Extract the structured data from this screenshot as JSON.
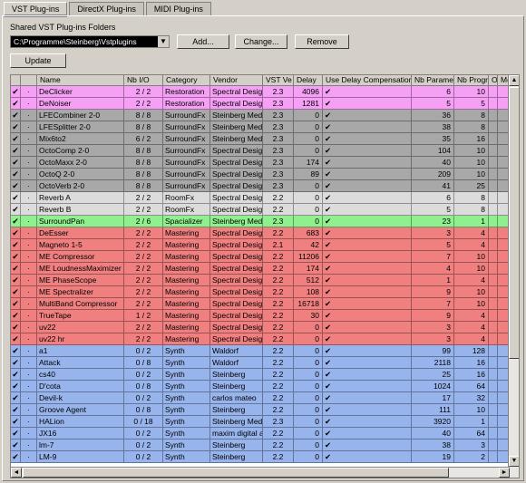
{
  "tabs": [
    "VST Plug-ins",
    "DirectX Plug-ins",
    "MIDI Plug-ins"
  ],
  "folders_label": "Shared VST Plug-ins Folders",
  "path": "C:\\Programme\\Steinberg\\Vstplugins",
  "buttons": {
    "add": "Add...",
    "change": "Change...",
    "remove": "Remove",
    "update": "Update"
  },
  "colors": {
    "pink": "#f5a0f5",
    "gray": "#a8a8a8",
    "light": "#dcdcdc",
    "green": "#90f090",
    "red": "#f07f7f",
    "blue": "#98b4ec"
  },
  "columns": [
    "",
    "",
    "Name",
    "Nb I/O",
    "Category",
    "Vendor",
    "VST Ve",
    "Delay",
    "Use Delay Compensation",
    "Nb Parame",
    "Nb Progra",
    "O",
    "Me"
  ],
  "rows": [
    {
      "on": "✔",
      "m": "·",
      "name": "DeClicker",
      "io": "2 / 2",
      "cat": "Restoration",
      "vendor": "Spectral Design",
      "ver": "2.3",
      "delay": "4096",
      "udc": "✔",
      "params": "6",
      "progs": "10",
      "color": "pink"
    },
    {
      "on": "✔",
      "m": "·",
      "name": "DeNoiser",
      "io": "2 / 2",
      "cat": "Restoration",
      "vendor": "Spectral Design",
      "ver": "2.3",
      "delay": "1281",
      "udc": "✔",
      "params": "5",
      "progs": "5",
      "color": "pink"
    },
    {
      "on": "✔",
      "m": "·",
      "name": "LFECombiner 2-0",
      "io": "8 / 8",
      "cat": "SurroundFx",
      "vendor": "Steinberg Media",
      "ver": "2.3",
      "delay": "0",
      "udc": "✔",
      "params": "36",
      "progs": "8",
      "color": "gray"
    },
    {
      "on": "✔",
      "m": "·",
      "name": "LFESplitter 2-0",
      "io": "8 / 8",
      "cat": "SurroundFx",
      "vendor": "Steinberg Media",
      "ver": "2.3",
      "delay": "0",
      "udc": "✔",
      "params": "38",
      "progs": "8",
      "color": "gray"
    },
    {
      "on": "✔",
      "m": "·",
      "name": "Mix6to2",
      "io": "6 / 2",
      "cat": "SurroundFx",
      "vendor": "Steinberg Media",
      "ver": "2.3",
      "delay": "0",
      "udc": "✔",
      "params": "35",
      "progs": "16",
      "color": "gray"
    },
    {
      "on": "✔",
      "m": "·",
      "name": "OctoComp 2-0",
      "io": "8 / 8",
      "cat": "SurroundFx",
      "vendor": "Spectral Design",
      "ver": "2.3",
      "delay": "0",
      "udc": "✔",
      "params": "104",
      "progs": "10",
      "color": "gray"
    },
    {
      "on": "✔",
      "m": "·",
      "name": "OctoMaxx 2-0",
      "io": "8 / 8",
      "cat": "SurroundFx",
      "vendor": "Spectral Design",
      "ver": "2.3",
      "delay": "174",
      "udc": "✔",
      "params": "40",
      "progs": "10",
      "color": "gray"
    },
    {
      "on": "✔",
      "m": "·",
      "name": "OctoQ 2-0",
      "io": "8 / 8",
      "cat": "SurroundFx",
      "vendor": "Spectral Design",
      "ver": "2.3",
      "delay": "89",
      "udc": "✔",
      "params": "209",
      "progs": "10",
      "color": "gray"
    },
    {
      "on": "✔",
      "m": "·",
      "name": "OctoVerb 2-0",
      "io": "8 / 8",
      "cat": "SurroundFx",
      "vendor": "Spectral Design",
      "ver": "2.3",
      "delay": "0",
      "udc": "✔",
      "params": "41",
      "progs": "25",
      "color": "gray"
    },
    {
      "on": "✔",
      "m": "·",
      "name": "Reverb A",
      "io": "2 / 2",
      "cat": "RoomFx",
      "vendor": "Spectral Design",
      "ver": "2.2",
      "delay": "0",
      "udc": "✔",
      "params": "6",
      "progs": "8",
      "color": "light"
    },
    {
      "on": "✔",
      "m": "·",
      "name": "Reverb B",
      "io": "2 / 2",
      "cat": "RoomFx",
      "vendor": "Spectral Design",
      "ver": "2.2",
      "delay": "0",
      "udc": "✔",
      "params": "5",
      "progs": "8",
      "color": "light"
    },
    {
      "on": "✔",
      "m": "·",
      "name": "SurroundPan",
      "io": "2 / 6",
      "cat": "Spacializer",
      "vendor": "Steinberg Media",
      "ver": "2.3",
      "delay": "0",
      "udc": "✔",
      "params": "23",
      "progs": "1",
      "color": "green"
    },
    {
      "on": "✔",
      "m": "·",
      "name": "DeEsser",
      "io": "2 / 2",
      "cat": "Mastering",
      "vendor": "Spectral Design",
      "ver": "2.2",
      "delay": "683",
      "udc": "✔",
      "params": "3",
      "progs": "4",
      "color": "red"
    },
    {
      "on": "✔",
      "m": "·",
      "name": "Magneto 1-5",
      "io": "2 / 2",
      "cat": "Mastering",
      "vendor": "Spectral Design",
      "ver": "2.1",
      "delay": "42",
      "udc": "✔",
      "params": "5",
      "progs": "4",
      "color": "red"
    },
    {
      "on": "✔",
      "m": "·",
      "name": "ME Compressor",
      "io": "2 / 2",
      "cat": "Mastering",
      "vendor": "Spectral Design",
      "ver": "2.2",
      "delay": "11206",
      "udc": "✔",
      "params": "7",
      "progs": "10",
      "color": "red"
    },
    {
      "on": "✔",
      "m": "·",
      "name": "ME LoudnessMaximizer",
      "io": "2 / 2",
      "cat": "Mastering",
      "vendor": "Spectral Design",
      "ver": "2.2",
      "delay": "174",
      "udc": "✔",
      "params": "4",
      "progs": "10",
      "color": "red"
    },
    {
      "on": "✔",
      "m": "·",
      "name": "ME PhaseScope",
      "io": "2 / 2",
      "cat": "Mastering",
      "vendor": "Spectral Design",
      "ver": "2.2",
      "delay": "512",
      "udc": "✔",
      "params": "1",
      "progs": "4",
      "color": "red"
    },
    {
      "on": "✔",
      "m": "·",
      "name": "ME Spectralizer",
      "io": "2 / 2",
      "cat": "Mastering",
      "vendor": "Spectral Design",
      "ver": "2.2",
      "delay": "108",
      "udc": "✔",
      "params": "9",
      "progs": "10",
      "color": "red"
    },
    {
      "on": "✔",
      "m": "·",
      "name": "MultiBand Compressor",
      "io": "2 / 2",
      "cat": "Mastering",
      "vendor": "Spectral Design",
      "ver": "2.2",
      "delay": "16718",
      "udc": "✔",
      "params": "7",
      "progs": "10",
      "color": "red"
    },
    {
      "on": "✔",
      "m": "·",
      "name": "TrueTape",
      "io": "1 / 2",
      "cat": "Mastering",
      "vendor": "Spectral Design",
      "ver": "2.2",
      "delay": "30",
      "udc": "✔",
      "params": "9",
      "progs": "4",
      "color": "red"
    },
    {
      "on": "✔",
      "m": "·",
      "name": "uv22",
      "io": "2 / 2",
      "cat": "Mastering",
      "vendor": "Spectral Design",
      "ver": "2.2",
      "delay": "0",
      "udc": "✔",
      "params": "3",
      "progs": "4",
      "color": "red"
    },
    {
      "on": "✔",
      "m": "·",
      "name": "uv22 hr",
      "io": "2 / 2",
      "cat": "Mastering",
      "vendor": "Spectral Design",
      "ver": "2.2",
      "delay": "0",
      "udc": "✔",
      "params": "3",
      "progs": "4",
      "color": "red"
    },
    {
      "on": "✔",
      "m": "·",
      "name": "a1",
      "io": "0 / 2",
      "cat": "Synth",
      "vendor": "Waldorf",
      "ver": "2.2",
      "delay": "0",
      "udc": "✔",
      "params": "99",
      "progs": "128",
      "color": "blue"
    },
    {
      "on": "✔",
      "m": "·",
      "name": "Attack",
      "io": "0 / 8",
      "cat": "Synth",
      "vendor": "Waldorf",
      "ver": "2.2",
      "delay": "0",
      "udc": "✔",
      "params": "2118",
      "progs": "16",
      "color": "blue"
    },
    {
      "on": "✔",
      "m": "·",
      "name": "cs40",
      "io": "0 / 2",
      "cat": "Synth",
      "vendor": "Steinberg",
      "ver": "2.2",
      "delay": "0",
      "udc": "✔",
      "params": "25",
      "progs": "16",
      "color": "blue"
    },
    {
      "on": "✔",
      "m": "·",
      "name": "D'cota",
      "io": "0 / 8",
      "cat": "Synth",
      "vendor": "Steinberg",
      "ver": "2.2",
      "delay": "0",
      "udc": "✔",
      "params": "1024",
      "progs": "64",
      "color": "blue"
    },
    {
      "on": "✔",
      "m": "·",
      "name": "Devil-k",
      "io": "0 / 2",
      "cat": "Synth",
      "vendor": "carlos mateo",
      "ver": "2.2",
      "delay": "0",
      "udc": "✔",
      "params": "17",
      "progs": "32",
      "color": "blue"
    },
    {
      "on": "✔",
      "m": "·",
      "name": "Groove Agent",
      "io": "0 / 8",
      "cat": "Synth",
      "vendor": "Steinberg",
      "ver": "2.2",
      "delay": "0",
      "udc": "✔",
      "params": "111",
      "progs": "10",
      "color": "blue"
    },
    {
      "on": "✔",
      "m": "·",
      "name": "HALion",
      "io": "0 / 18",
      "cat": "Synth",
      "vendor": "Steinberg Media",
      "ver": "2.3",
      "delay": "0",
      "udc": "✔",
      "params": "3920",
      "progs": "1",
      "color": "blue"
    },
    {
      "on": "✔",
      "m": "·",
      "name": "JX16",
      "io": "0 / 2",
      "cat": "Synth",
      "vendor": "maxim digital au",
      "ver": "2.2",
      "delay": "0",
      "udc": "✔",
      "params": "40",
      "progs": "64",
      "color": "blue"
    },
    {
      "on": "✔",
      "m": "·",
      "name": "lm-7",
      "io": "0 / 2",
      "cat": "Synth",
      "vendor": "Steinberg",
      "ver": "2.2",
      "delay": "0",
      "udc": "✔",
      "params": "38",
      "progs": "3",
      "color": "blue"
    },
    {
      "on": "✔",
      "m": "·",
      "name": "LM-9",
      "io": "0 / 2",
      "cat": "Synth",
      "vendor": "Steinberg",
      "ver": "2.2",
      "delay": "0",
      "udc": "✔",
      "params": "19",
      "progs": "2",
      "color": "blue"
    }
  ]
}
